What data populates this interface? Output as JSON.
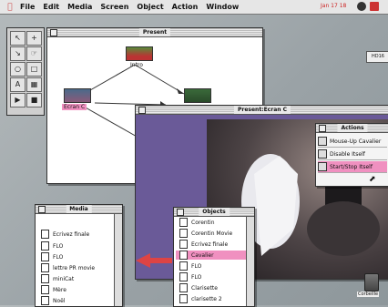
{
  "menubar": {
    "items": [
      "File",
      "Edit",
      "Media",
      "Screen",
      "Object",
      "Action",
      "Window"
    ],
    "clock": "Jan 17 18"
  },
  "present_window": {
    "title": "Present",
    "nodes": {
      "intro": "Intro",
      "ecran": "Ecran C"
    }
  },
  "preview_window": {
    "title": "Present:Ecran C"
  },
  "right_edge_label": "HD16",
  "actions": {
    "title": "Actions",
    "items": [
      "Mouse-Up Cavalier",
      "Disable Itself",
      "Start/Stop Itself"
    ]
  },
  "media": {
    "title": "Media",
    "items": [
      "Ecrivez finale",
      "FLO",
      "FLO",
      "lettre PR movie",
      "miniCat",
      "Mère",
      "Noël"
    ]
  },
  "objects": {
    "title": "Objects",
    "items": [
      "Corentin",
      "Corentin Movie",
      "Ecrivez finale",
      "Cavalier",
      "FLO",
      "FLO",
      "Clarisette",
      "clarisette 2"
    ],
    "selected": "Cavalier"
  },
  "trash_label": "Corbeille",
  "colors": {
    "selection": "#f090c0",
    "preview_bg": "#6a5a98"
  }
}
